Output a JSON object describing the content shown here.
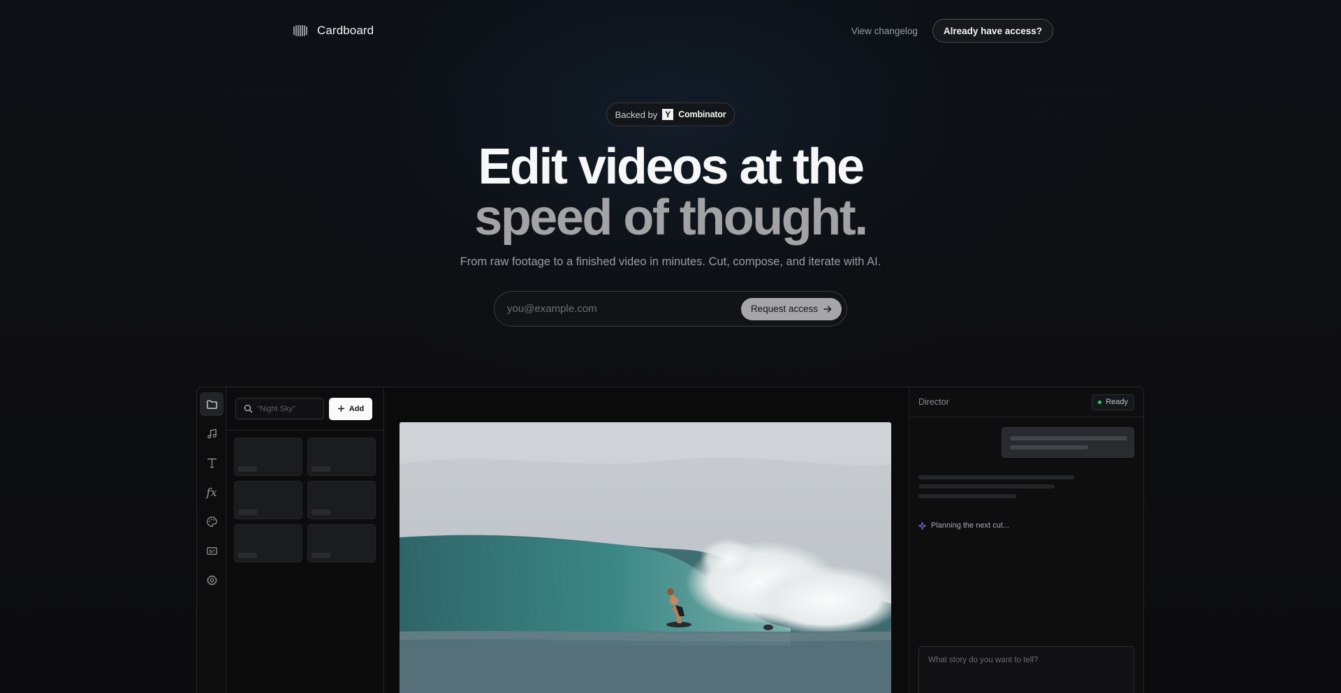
{
  "nav": {
    "brand": "Cardboard",
    "changelog_label": "View changelog",
    "access_label": "Already have access?"
  },
  "hero": {
    "badge_prefix": "Backed by",
    "badge_logo_letter": "Y",
    "badge_brand": "Combinator",
    "headline_line1": "Edit videos at the",
    "headline_line2": "speed of thought.",
    "subtitle": "From raw footage to a finished video in minutes. Cut, compose, and iterate with AI.",
    "email_placeholder": "you@example.com",
    "request_label": "Request access"
  },
  "editor": {
    "rail": [
      "folder-icon",
      "music-note-icon",
      "text-icon",
      "fx-icon",
      "palette-icon",
      "captions-icon",
      "settings-gear-icon"
    ],
    "fx_glyph": "fx",
    "search_placeholder": "\"Night Sky\"",
    "add_label": "Add",
    "director": {
      "title": "Director",
      "status": "Ready",
      "status_color": "#2fcf6a",
      "planning_text": "Planning the next cut...",
      "prompt_placeholder": "What story do you want to tell?"
    }
  },
  "colors": {
    "background": "#0c0c0e",
    "headline_primary": "#f7f7f7",
    "headline_secondary": "#a3a3a6",
    "request_button": "#a6a6a8",
    "planning_icon": "#8b7cf6"
  }
}
